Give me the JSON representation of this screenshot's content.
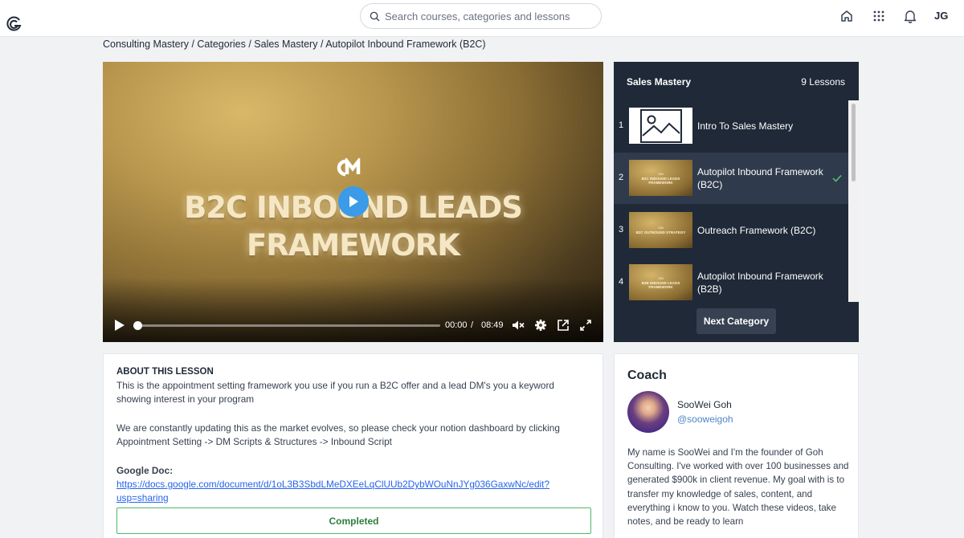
{
  "topbar": {
    "search_placeholder": "Search courses, categories and lessons",
    "user_initials": "JG",
    "icons": [
      "logo-icon",
      "search-icon",
      "home-icon",
      "apps-grid-icon",
      "bell-icon"
    ]
  },
  "breadcrumb": "Consulting Mastery / Categories / Sales Mastery / Autopilot Inbound Framework (B2C)",
  "video": {
    "title_line1": "B2C INBOUND LEADS",
    "title_line2": "FRAMEWORK",
    "current_time": "00:00",
    "separator": "/",
    "duration": "08:49",
    "progress": 0
  },
  "playlist": {
    "title": "Sales Mastery",
    "count": "9 Lessons",
    "lessons": [
      {
        "num": "1",
        "name": "Intro To Sales Mastery",
        "thumb_text": ""
      },
      {
        "num": "2",
        "name": "Autopilot Inbound Framework (B2C)",
        "thumb_text": "B2C INBOUND LEADS FRAMEWORK",
        "completed": true,
        "active": true
      },
      {
        "num": "3",
        "name": "Outreach Framework (B2C)",
        "thumb_text": "B2C OUTBOUND STRATEGY"
      },
      {
        "num": "4",
        "name": "Autopilot Inbound Framework (B2B)",
        "thumb_text": "B2B INBOUND LEADS FRAMEWORK"
      }
    ],
    "thumb_logo": "CM",
    "next_button": "Next Category"
  },
  "about": {
    "heading": "ABOUT THIS LESSON",
    "para1": "This is the appointment setting framework you use if you run a B2C offer and a lead DM's you a keyword showing interest in your program",
    "para2": "We are constantly updating this as the market evolves, so please check your notion dashboard by clicking Appointment Setting -> DM Scripts & Structures -> Inbound Script",
    "doc_label": "Google Doc:",
    "doc_link": "https://docs.google.com/document/d/1oL3B3SbdLMeDXEeLqClUUb2DybWOuNnJYg036GaxwNc/edit?usp=sharing",
    "completed_button": "Completed"
  },
  "coach": {
    "heading": "Coach",
    "name": "SooWei Goh",
    "handle": "@sooweigoh",
    "bio": "My name is SooWei and I'm the founder of Goh Consulting. I've worked with over 100 businesses and generated $900k in client revenue. My goal with is to transfer my knowledge of sales, content, and everything i know to you. Watch these videos, take notes, and be ready to learn"
  },
  "colors": {
    "accent": "#3b9be8",
    "playlist_bg": "#1f2937",
    "completed_green": "#4fb86c",
    "link_blue": "#2563eb"
  }
}
